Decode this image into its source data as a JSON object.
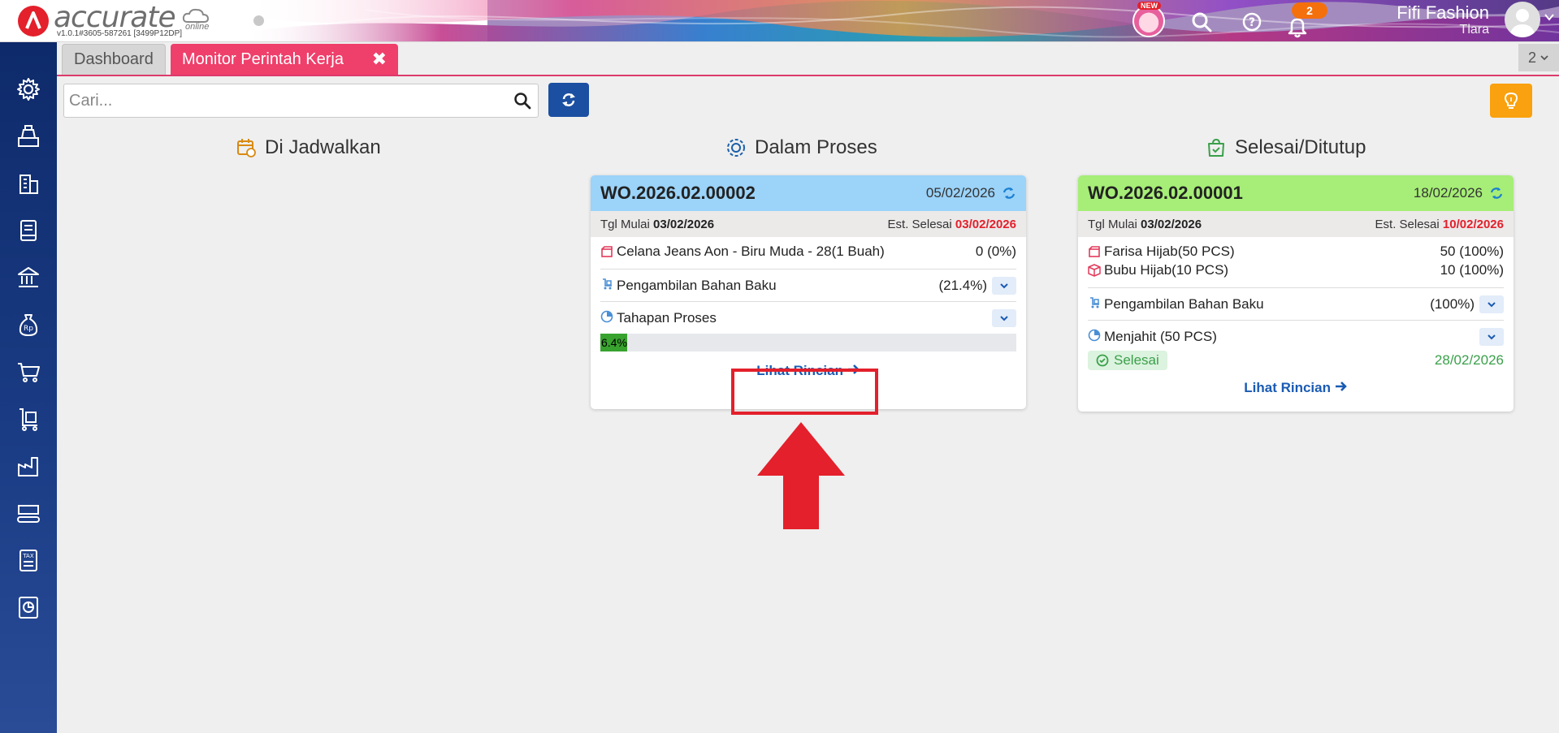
{
  "header": {
    "logo_text": "accurate",
    "logo_sub": "online",
    "version": "v1.0.1#3605-587261 [3499P12DP]",
    "new_label": "NEW",
    "notifications": "2",
    "user_name": "Fifi Fashion",
    "user_sub": "Tlara"
  },
  "sidebar": {
    "icons": [
      "gear-icon",
      "cash-register-icon",
      "building-icon",
      "ledger-icon",
      "bank-icon",
      "money-bag-icon",
      "cart-icon",
      "trolley-icon",
      "factory-icon",
      "conveyor-icon",
      "tax-icon",
      "report-icon"
    ]
  },
  "tabs": {
    "dashboard": "Dashboard",
    "active": "Monitor Perintah Kerja",
    "close": "✖",
    "count": "2"
  },
  "search": {
    "placeholder": "Cari..."
  },
  "columns": {
    "scheduled": "Di Jadwalkan",
    "in_process": "Dalam Proses",
    "done": "Selesai/Ditutup"
  },
  "cards": [
    {
      "wo": "WO.2026.02.00002",
      "date": "05/02/2026",
      "start_label": "Tgl Mulai",
      "start": "03/02/2026",
      "est_label": "Est. Selesai",
      "est": "03/02/2026",
      "products": [
        {
          "name": "Celana Jeans Aon - Biru Muda - 28(1 Buah)",
          "value": "0 (0%)"
        }
      ],
      "material_label": "Pengambilan Bahan Baku",
      "material_value": "(21.4%)",
      "process_label": "Tahapan Proses",
      "progress_text": "6.4%",
      "progress": 0.064,
      "link": "Lihat Rincian"
    },
    {
      "wo": "WO.2026.02.00001",
      "date": "18/02/2026",
      "start_label": "Tgl Mulai",
      "start": "03/02/2026",
      "est_label": "Est. Selesai",
      "est": "10/02/2026",
      "products": [
        {
          "name": "Farisa Hijab(50 PCS)",
          "value": "50 (100%)"
        },
        {
          "name": "Bubu Hijab(10 PCS)",
          "value": "10 (100%)"
        }
      ],
      "material_label": "Pengambilan Bahan Baku",
      "material_value": "(100%)",
      "process_label": "Menjahit (50 PCS)",
      "status": "Selesai",
      "status_date": "28/02/2026",
      "link": "Lihat Rincian"
    }
  ],
  "colors": {
    "brand_red": "#e3202b",
    "tab_active": "#ef3f6b",
    "card1_header": "#9bd3f9",
    "card2_header": "#a6ee77",
    "link": "#1a5bb3",
    "progress_fill": "#38a22f"
  }
}
